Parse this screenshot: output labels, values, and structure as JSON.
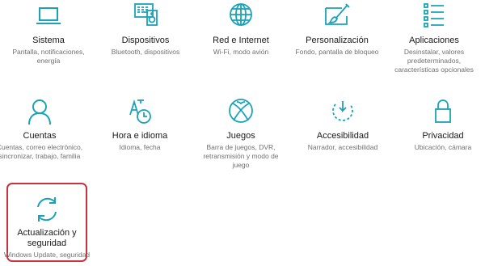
{
  "accent_color": "#1aa3b8",
  "highlight_color": "#c8323c",
  "tiles": [
    {
      "id": "sistema",
      "icon": "laptop-icon",
      "title": "Sistema",
      "desc": "Pantalla, notificaciones, energía"
    },
    {
      "id": "dispositivos",
      "icon": "devices-icon",
      "title": "Dispositivos",
      "desc": "Bluetooth, dispositivos"
    },
    {
      "id": "red",
      "icon": "globe-icon",
      "title": "Red e Internet",
      "desc": "Wi-Fi, modo avión"
    },
    {
      "id": "personalizacion",
      "icon": "paintbrush-icon",
      "title": "Personalización",
      "desc": "Fondo, pantalla de bloqueo"
    },
    {
      "id": "aplicaciones",
      "icon": "apps-list-icon",
      "title": "Aplicaciones",
      "desc": "Desinstalar, valores predeterminados, características opcionales"
    },
    {
      "id": "cuentas",
      "icon": "person-icon",
      "title": "Cuentas",
      "desc": "Cuentas, correo electrónico, sincronizar, trabajo, familia"
    },
    {
      "id": "hora",
      "icon": "time-language-icon",
      "title": "Hora e idioma",
      "desc": "Idioma, fecha"
    },
    {
      "id": "juegos",
      "icon": "xbox-icon",
      "title": "Juegos",
      "desc": "Barra de juegos, DVR, retransmisión y modo de juego"
    },
    {
      "id": "accesibilidad",
      "icon": "ease-of-access-icon",
      "title": "Accesibilidad",
      "desc": "Narrador, accesibilidad"
    },
    {
      "id": "privacidad",
      "icon": "lock-icon",
      "title": "Privacidad",
      "desc": "Ubicación, cámara"
    },
    {
      "id": "actualizacion",
      "icon": "refresh-icon",
      "title": "Actualización y seguridad",
      "desc": "Windows Update, seguridad"
    }
  ]
}
